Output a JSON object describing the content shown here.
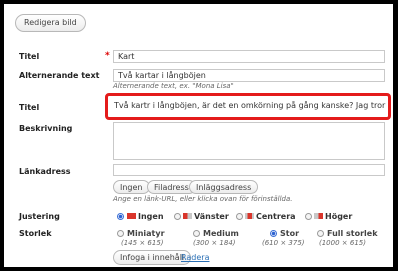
{
  "toolbar": {
    "edit_image_label": "Redigera bild"
  },
  "fields": {
    "title1": {
      "label": "Titel",
      "required_mark": "*",
      "value": "Kart"
    },
    "alt_text": {
      "label": "Alternerande text",
      "value": "Två kartar i långböjen",
      "hint": "Alternerande text, ex. \"Mona Lisa\""
    },
    "title2": {
      "label": "Titel",
      "value": "Två kartr i långböjen, är det en omkörning på gång kanske? Jag tror no"
    },
    "description": {
      "label": "Beskrivning",
      "value": ""
    },
    "link_url": {
      "label": "Länkadress",
      "value": "",
      "buttons": [
        "Ingen",
        "Filadress",
        "Inläggsadress"
      ],
      "hint": "Ange en länk-URL, eller klicka ovan för förinställda."
    }
  },
  "alignment": {
    "label": "Justering",
    "selected": "Ingen",
    "options": [
      "Ingen",
      "Vänster",
      "Centrera",
      "Höger"
    ]
  },
  "size": {
    "label": "Storlek",
    "selected": "Stor",
    "options": [
      {
        "name": "Miniatyr",
        "dims": "(145 × 615)"
      },
      {
        "name": "Medium",
        "dims": "(300 × 184)"
      },
      {
        "name": "Stor",
        "dims": "(610 × 375)"
      },
      {
        "name": "Full storlek",
        "dims": "(1000 × 615)"
      }
    ]
  },
  "actions": {
    "insert_label": "Infoga i innehåll",
    "delete_label": "Radera"
  },
  "colors": {
    "highlight": "#e41b1b",
    "swatch_red": "#d9352b",
    "swatch_gray": "#c8c8c8",
    "link": "#2a6fb5"
  }
}
